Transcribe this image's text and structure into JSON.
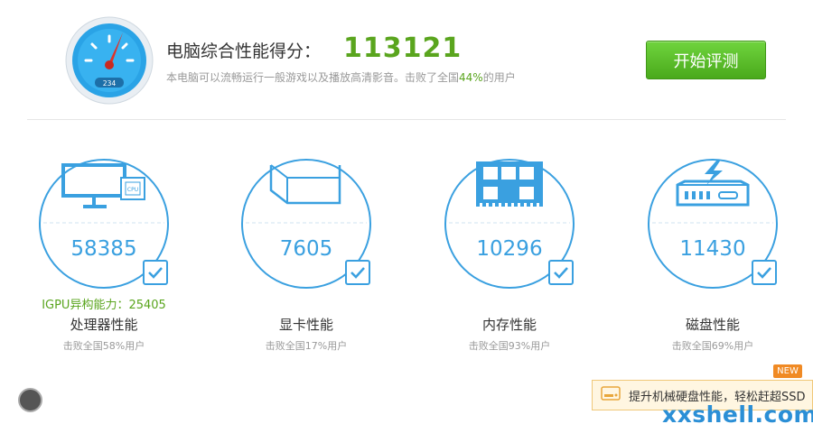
{
  "header": {
    "score_title": "电脑综合性能得分：",
    "score_value": "113121",
    "desc_prefix": "本电脑可以流畅运行一般游戏以及播放高清影音。击败了全国",
    "desc_percent": "44%",
    "desc_suffix": "的用户",
    "start_button": "开始评测",
    "gauge_display": "234"
  },
  "cards": [
    {
      "id": "cpu",
      "icon": "cpu-monitor-icon",
      "icon_text": "CPU",
      "score": "58385",
      "extra": "IGPU异构能力：25405",
      "label": "处理器性能",
      "sub": "击败全国58%用户"
    },
    {
      "id": "gpu",
      "icon": "graphics-cube-icon",
      "score": "7605",
      "label": "显卡性能",
      "sub": "击败全国17%用户"
    },
    {
      "id": "memory",
      "icon": "memory-chip-icon",
      "score": "10296",
      "label": "内存性能",
      "sub": "击败全国93%用户"
    },
    {
      "id": "disk",
      "icon": "hard-disk-icon",
      "score": "11430",
      "label": "磁盘性能",
      "sub": "击败全国69%用户"
    }
  ],
  "promo": {
    "text": "提升机械硬盘性能，轻松赶超SSD",
    "badge": "NEW"
  },
  "watermark": "xxshell.com",
  "colors": {
    "accent_blue": "#3aa0e0",
    "green": "#5aa51e",
    "badge_orange": "#f08a24"
  }
}
